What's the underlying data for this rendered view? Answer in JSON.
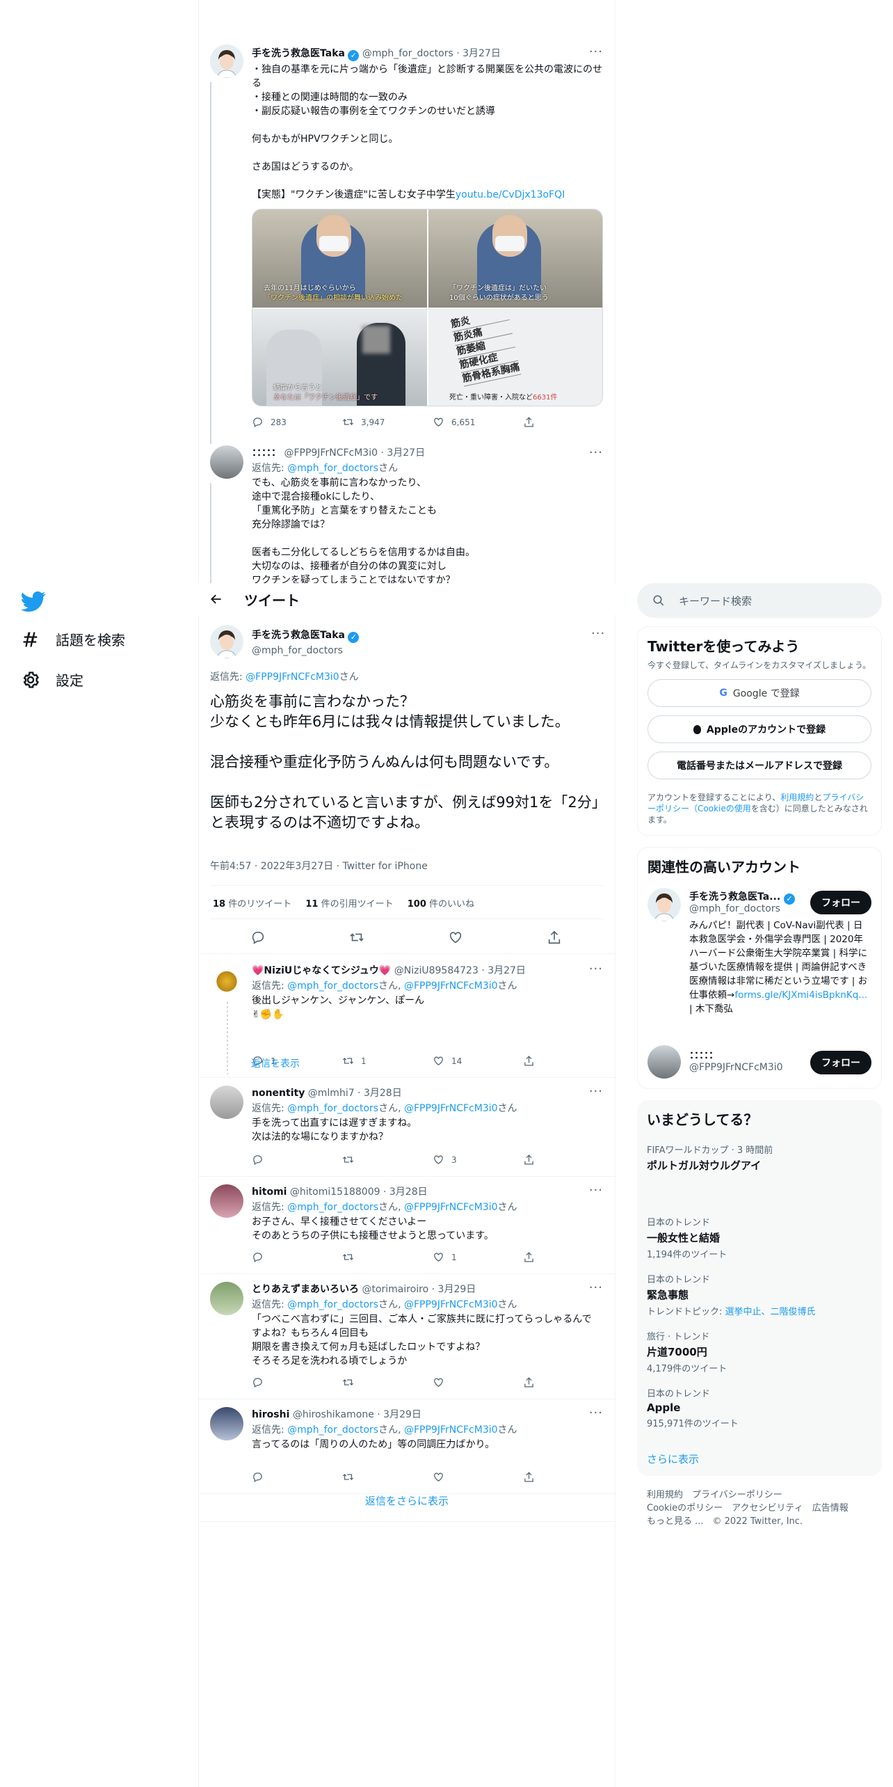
{
  "nav": {
    "explore": "話題を検索",
    "settings": "設定"
  },
  "header": {
    "title": "ツイート"
  },
  "top_tweet": {
    "name": "手を洗う救急医Taka",
    "handle": "@mph_for_doctors",
    "date": "· 3月27日",
    "body": "・独自の基準を元に片っ端から「後遺症」と診断する開業医を公共の電波にのせる\n・接種との関連は時間的な一致のみ\n・副反応疑い報告の事例を全てワクチンのせいだと誘導\n\n何もかもがHPVワクチンと同じ。\n\nさあ国はどうするのか。\n\n【実態】\"ワクチン後遺症\"に苦しむ女子中学生",
    "link": "youtu.be/CvDjx13oFQI",
    "img1_caption_a": "去年の11月はじめぐらいから",
    "img1_caption_b": "「ワクチン後遺症」の相談が舞い込み始めた",
    "img2_caption_a": "「ワクチン後遺症は」だいたい",
    "img2_caption_b": "10個ぐらいの症状があると思う",
    "img3_caption_a": "結論から言うと",
    "img3_caption_b": "あなたは「ワクチン後遺症」です",
    "img4_words": [
      "筋炎",
      "筋炎痛",
      "筋萎縮",
      "筋硬化症",
      "筋骨格系胸痛"
    ],
    "img4_caption": "死亡・重い障害・入院など",
    "img4_num": "6631件",
    "replies": "283",
    "retweets": "3,947",
    "likes": "6,651"
  },
  "mid_reply": {
    "name": "：：：：：",
    "handle": "@FPP9JFrNCFcM3i0",
    "date": "· 3月27日",
    "reply_prefix": "返信先: ",
    "reply_to": "@mph_for_doctors",
    "reply_suffix": "さん",
    "body": "でも、心筋炎を事前に言わなかったり、\n途中で混合接種okにしたり、\n「重篤化予防」と言葉をすり替えたことも\n充分除謬論では？\n\n医者も二分化してるしどちらを信用するかは自由。\n大切なのは、接種者が自分の体の異変に対し\nワクチンを疑ってしまうことではないですか？"
  },
  "main": {
    "name": "手を洗う救急医Taka",
    "handle": "@mph_for_doctors",
    "reply_prefix": "返信先: ",
    "reply_to": "@FPP9JFrNCFcM3i0",
    "reply_suffix": "さん",
    "body": "心筋炎を事前に言わなかった？\n少なくとも昨年6月には我々は情報提供していました。\n\n混合接種や重症化予防うんぬんは何も問題ないです。\n\n医師も2分されていると言いますが、例えば99対1を「2分」と表現するのは不適切ですよね。",
    "meta": "午前4:57 · 2022年3月27日 · Twitter for iPhone",
    "rt_num": "18",
    "rt_label": " 件のリツイート",
    "qt_num": "11",
    "qt_label": " 件の引用ツイート",
    "like_num": "100",
    "like_label": " 件のいいね"
  },
  "replies": [
    {
      "name": "💗NiziUじゃなくてシジュウ💗",
      "handle": "@NiziU89584723",
      "date": "· 3月27日",
      "to_a": "@mph_for_doctors",
      "mid": "さん, ",
      "to_b": "@FPP9JFrNCFcM3i0",
      "suffix": "さん",
      "body": "後出しジャンケン、ジャンケン、ぽーん\n✌✊✋",
      "replies": "1",
      "retweets": "1",
      "likes": "14"
    },
    {
      "name": "nonentity",
      "handle": "@mlmhi7",
      "date": "· 3月28日",
      "to_a": "@mph_for_doctors",
      "mid": "さん, ",
      "to_b": "@FPP9JFrNCFcM3i0",
      "suffix": "さん",
      "body": "手を洗って出直すには遅すぎますね。\n次は法的な場になりますかね？",
      "replies": "",
      "retweets": "",
      "likes": "3"
    },
    {
      "name": "hitomi",
      "handle": "@hitomi15188009",
      "date": "· 3月28日",
      "to_a": "@mph_for_doctors",
      "mid": "さん, ",
      "to_b": "@FPP9JFrNCFcM3i0",
      "suffix": "さん",
      "body": "お子さん、早く接種させてくださいよー\nそのあとうちの子供にも接種させようと思っています。",
      "replies": "",
      "retweets": "",
      "likes": "1"
    },
    {
      "name": "とりあえずまあいろいろ",
      "handle": "@torimairoiro",
      "date": "· 3月29日",
      "to_a": "@mph_for_doctors",
      "mid": "さん, ",
      "to_b": "@FPP9JFrNCFcM3i0",
      "suffix": "さん",
      "body": "「つべこべ言わずに」三回目、ご本人・ご家族共に既に打ってらっしゃるんですよね？もちろん４回目も\n期限を書き換えて何ヵ月も延ばしたロットですよね？\nそろそろ足を洗われる頃でしょうか",
      "replies": "",
      "retweets": "",
      "likes": ""
    },
    {
      "name": "hiroshi",
      "handle": "@hiroshikamone",
      "date": "· 3月29日",
      "to_a": "@mph_for_doctors",
      "mid": "さん, ",
      "to_b": "@FPP9JFrNCFcM3i0",
      "suffix": "さん",
      "body": "言ってるのは「周りの人のため」等の同調圧力ばかり。",
      "replies": "",
      "retweets": "",
      "likes": ""
    }
  ],
  "show_replies": "返信を表示",
  "show_more_replies": "返信をさらに表示",
  "right": {
    "search_placeholder": "キーワード検索",
    "signup": {
      "title": "Twitterを使ってみよう",
      "desc": "今すぐ登録して、タイムラインをカスタマイズしましょう。",
      "google": "Google で登録",
      "apple": "Appleのアカウントで登録",
      "phone": "電話番号またはメールアドレスで登録",
      "legal_a": "アカウントを登録することにより、",
      "legal_terms": "利用規約",
      "legal_b": "と",
      "legal_privacy": "プライバシーポリシー（Cookieの使用",
      "legal_c": "を含む）に同意したとみなされます。"
    },
    "related": {
      "title": "関連性の高いアカウント",
      "acc1_name": "手を洗う救急医Ta...",
      "acc1_handle": "@mph_for_doctors",
      "acc1_bio": "みんパピ！副代表 | CoV-Navi副代表 | 日本救急医学会・外傷学会専門医 | 2020年ハーバード公衆衛生大学院卒業賞 | 科学に基づいた医療情報を提供 | 両論併記すべき医療情報は非常に稀だという立場です | お仕事依頼→",
      "acc1_link": "forms.gle/KJXmi4isBpknKq...",
      "acc1_bio_end": " | 木下喬弘",
      "acc2_name": "：：：：：",
      "acc2_handle": "@FPP9JFrNCFcM3i0",
      "follow": "フォロー"
    },
    "trends": {
      "title": "いまどうしてる？",
      "items": [
        {
          "ctx": "FIFAワールドカップ · 3 時間前",
          "title": "ポルトガル対ウルグアイ",
          "sub": ""
        },
        {
          "ctx": "日本のトレンド",
          "title": "一般女性と結婚",
          "sub": "1,194件のツイート"
        },
        {
          "ctx": "日本のトレンド",
          "title": "緊急事態",
          "sub": "トレンドトピック: ",
          "sub_link": "選挙中止、二階俊博氏"
        },
        {
          "ctx": "旅行 · トレンド",
          "title": "片道7000円",
          "sub": "4,179件のツイート"
        },
        {
          "ctx": "日本のトレンド",
          "title": "Apple",
          "sub": "915,971件のツイート"
        }
      ],
      "more": "さらに表示"
    },
    "footer": {
      "l1": "利用規約　プライバシーポリシー",
      "l2": "Cookieのポリシー　アクセシビリティ　広告情報",
      "l3": "もっと見る ...　© 2022 Twitter, Inc."
    }
  }
}
